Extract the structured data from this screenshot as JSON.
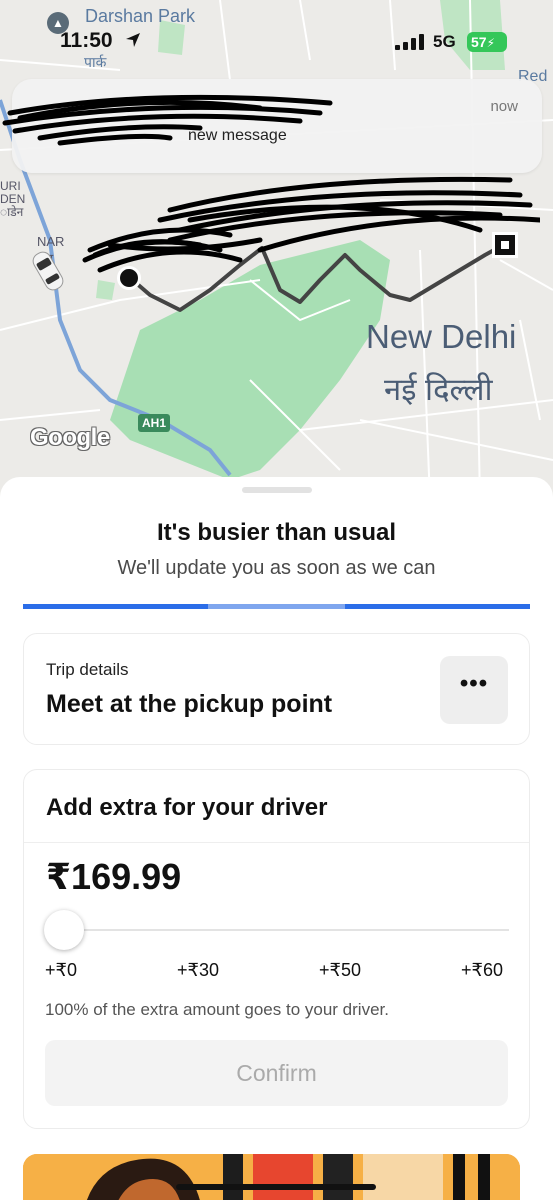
{
  "status_bar": {
    "time": "11:50",
    "network": "5G",
    "battery": "57"
  },
  "notification": {
    "message": "new message",
    "time": "now"
  },
  "map": {
    "labels": {
      "darshan_park": "Darshan Park",
      "park_hindi": "पार्क",
      "red": "Red",
      "uri_den": "URI\nDEN\nाडेन",
      "nar": "NAR\nराय",
      "new_delhi": "New Delhi",
      "new_delhi_hindi": "नई दिल्ली",
      "highway": "AH1",
      "google": "Google"
    }
  },
  "sheet": {
    "headline": "It's busier than usual",
    "subline": "We'll update you as soon as we can",
    "trip": {
      "label": "Trip details",
      "title": "Meet at the pickup point",
      "more": "•••"
    },
    "tip": {
      "title": "Add extra for your driver",
      "amount": "₹169.99",
      "ticks": [
        "+₹0",
        "+₹30",
        "+₹50",
        "+₹60"
      ],
      "note": "100% of the extra amount goes to your driver.",
      "confirm": "Confirm"
    }
  },
  "colors": {
    "accent_blue": "#2b6de8",
    "park_green": "#a8dfb4",
    "battery_green": "#34c759"
  }
}
